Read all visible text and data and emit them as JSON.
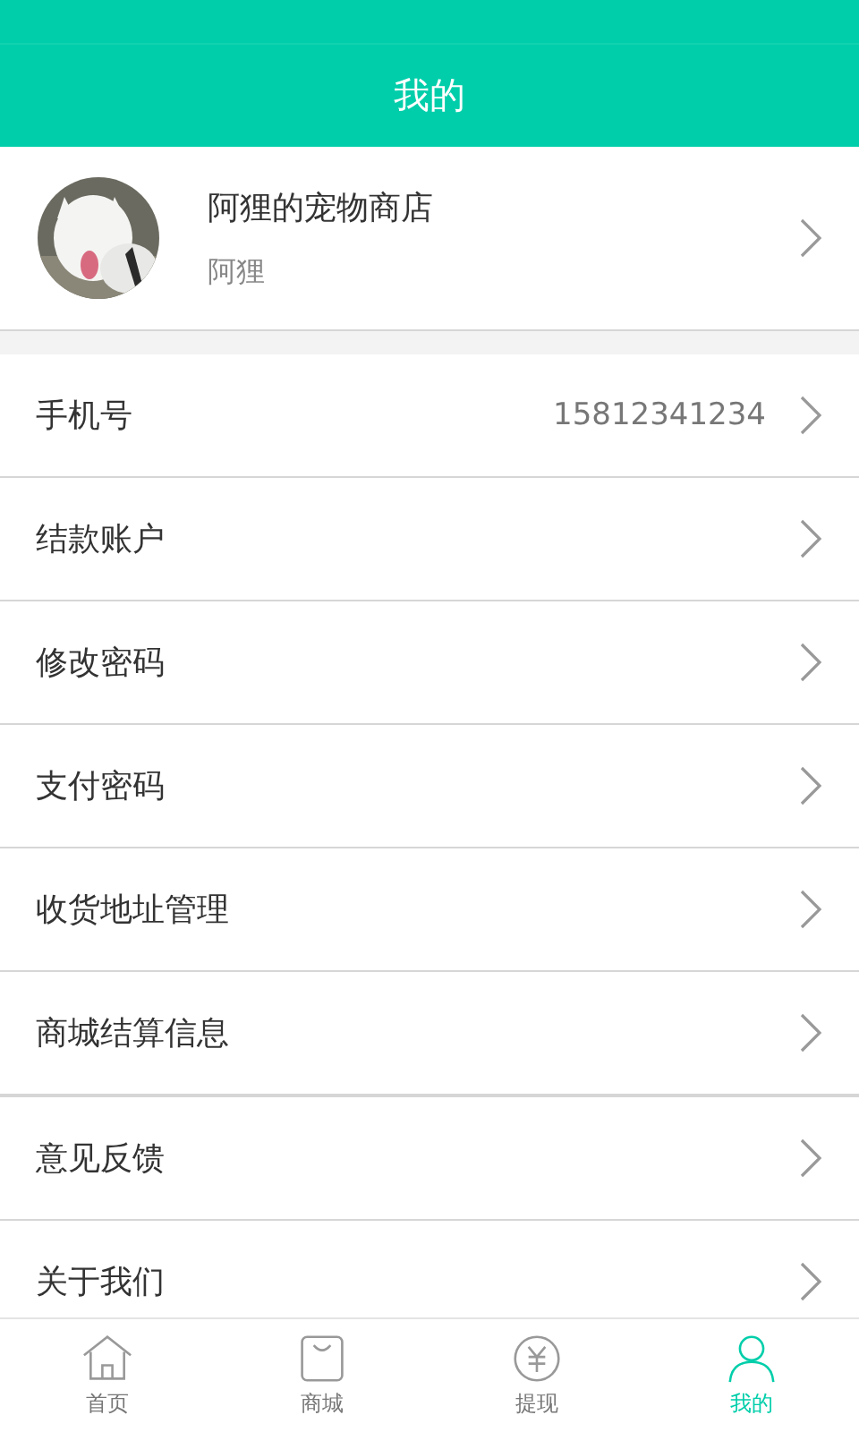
{
  "header": {
    "title": "我的"
  },
  "profile": {
    "shop_name": "阿狸的宠物商店",
    "user_name": "阿狸"
  },
  "menu_groups": [
    {
      "items": [
        {
          "label": "手机号",
          "value": "15812341234"
        },
        {
          "label": "结款账户"
        },
        {
          "label": "修改密码"
        },
        {
          "label": "支付密码"
        },
        {
          "label": "收货地址管理"
        },
        {
          "label": "商城结算信息"
        }
      ]
    },
    {
      "items": [
        {
          "label": "意见反馈"
        },
        {
          "label": "关于我们"
        }
      ]
    }
  ],
  "tab_bar": [
    {
      "label": "首页",
      "kind": "home",
      "selected": false
    },
    {
      "label": "商城",
      "kind": "bag",
      "selected": false
    },
    {
      "label": "提现",
      "kind": "yuan",
      "selected": false
    },
    {
      "label": "我的",
      "kind": "person",
      "selected": true
    }
  ]
}
